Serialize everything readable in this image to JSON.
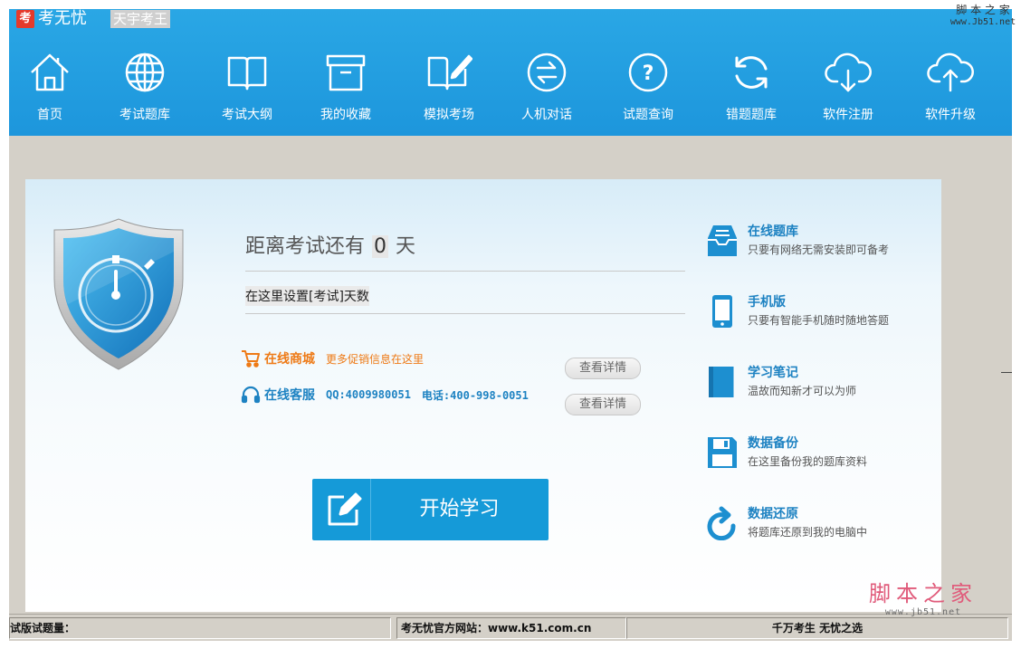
{
  "titlebar": {
    "logo_char": "考",
    "app_name": "考无忧",
    "subtitle": "天宇考王"
  },
  "nav": [
    {
      "label": "首页",
      "icon": "home-icon"
    },
    {
      "label": "考试题库",
      "icon": "globe-icon"
    },
    {
      "label": "考试大纲",
      "icon": "book-icon"
    },
    {
      "label": "我的收藏",
      "icon": "archive-box-icon"
    },
    {
      "label": "模拟考场",
      "icon": "book-pen-icon"
    },
    {
      "label": "人机对话",
      "icon": "exchange-arrows-icon"
    },
    {
      "label": "试题查询",
      "icon": "question-icon"
    },
    {
      "label": "错题题库",
      "icon": "refresh-icon"
    },
    {
      "label": "软件注册",
      "icon": "cloud-download-icon"
    },
    {
      "label": "软件升级",
      "icon": "cloud-upload-icon"
    }
  ],
  "countdown": {
    "prefix": "距离考试还有",
    "days": "0",
    "suffix": "天"
  },
  "set_days_label": "在这里设置[考试]天数",
  "shop": {
    "title": "在线商城",
    "desc": "更多促销信息在这里",
    "button": "查看详情"
  },
  "service": {
    "title": "在线客服",
    "qq": "QQ:4009980051",
    "phone": "电话:400-998-0051",
    "button": "查看详情"
  },
  "start_button": "开始学习",
  "features": [
    {
      "title": "在线题库",
      "desc": "只要有网络无需安装即可备考",
      "icon": "inbox-tray-icon"
    },
    {
      "title": "手机版",
      "desc": "只要有智能手机随时随地答题",
      "icon": "mobile-phone-icon"
    },
    {
      "title": "学习笔记",
      "desc": "温故而知新才可以为师",
      "icon": "notebook-icon"
    },
    {
      "title": "数据备份",
      "desc": "在这里备份我的题库资料",
      "icon": "floppy-disk-icon"
    },
    {
      "title": "数据还原",
      "desc": "将题库还原到我的电脑中",
      "icon": "restore-arrow-icon"
    }
  ],
  "statusbar": {
    "trial": "试版试题量：",
    "website": "考无忧官方网站：www.k51.com.cn",
    "slogan": "千万考生 无忧之选"
  },
  "watermark": {
    "top_text": "脚 本 之 家",
    "top_url": "www.Jb51.net",
    "bottom_text": "脚本之家",
    "bottom_url": "www.jb51.net"
  },
  "colors": {
    "header_blue": "#1d96dc",
    "accent_blue": "#159ad8",
    "link_blue": "#1d82c2",
    "shop_orange": "#ee7a16"
  }
}
